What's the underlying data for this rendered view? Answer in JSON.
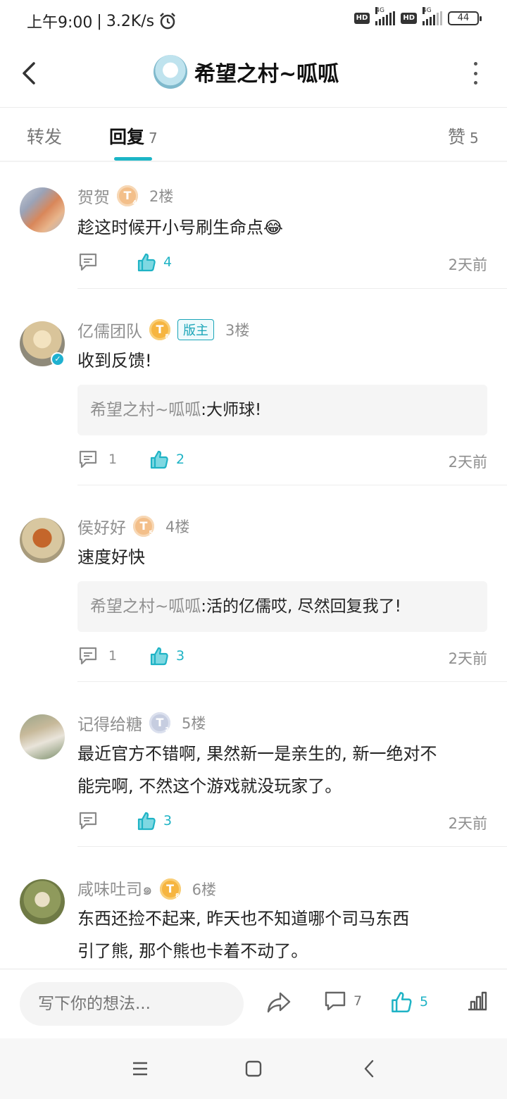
{
  "status": {
    "time": "上午9:00",
    "speed": "3.2K/s",
    "sep": "|",
    "network": "4G",
    "hd": "HD",
    "battery": "44"
  },
  "header": {
    "title": "希望之村~呱呱"
  },
  "tabs": [
    {
      "label": "转发",
      "count": ""
    },
    {
      "label": "回复",
      "count": "7"
    },
    {
      "label": "赞",
      "count": "5"
    }
  ],
  "comments": [
    {
      "author": "贺贺",
      "level": "T",
      "level_num": "4",
      "floor": "2楼",
      "content": "趁这时候开小号刷生命点😂",
      "reply_count": "",
      "like_count": "4",
      "time": "2天前"
    },
    {
      "author": "亿儒团队",
      "level": "T",
      "level_num": "8",
      "badge": "版主",
      "floor": "3楼",
      "content": "收到反馈!",
      "quote_name": "希望之村~呱呱",
      "quote_colon": ":",
      "quote_text": "大师球!",
      "reply_count": "1",
      "like_count": "2",
      "time": "2天前"
    },
    {
      "author": "侯好好",
      "level": "T",
      "level_num": "5",
      "floor": "4楼",
      "content": "速度好快",
      "quote_name": "希望之村~呱呱",
      "quote_colon": ":",
      "quote_text": "活的亿儒哎, 尽然回复我了!",
      "reply_count": "1",
      "like_count": "3",
      "time": "2天前"
    },
    {
      "author": "记得给糖",
      "level": "T",
      "level_num": "2",
      "floor": "5楼",
      "content_line1": "最近官方不错啊, 果然新一是亲生的, 新一绝对不",
      "content_line2": "能完啊, 不然这个游戏就没玩家了。",
      "reply_count": "",
      "like_count": "3",
      "time": "2天前"
    },
    {
      "author": "咸味吐司๑",
      "level": "T",
      "level_num": "8",
      "floor": "6楼",
      "content_line1": "东西还捡不起来, 昨天也不知道哪个司马东西",
      "content_line2": "引了熊, 那个熊也卡着不动了。"
    }
  ],
  "bottom": {
    "placeholder": "写下你的想法...",
    "comment_count": "7",
    "like_count": "5"
  },
  "colors": {
    "accent": "#1cb5c6",
    "muted": "#8f8f8f"
  }
}
